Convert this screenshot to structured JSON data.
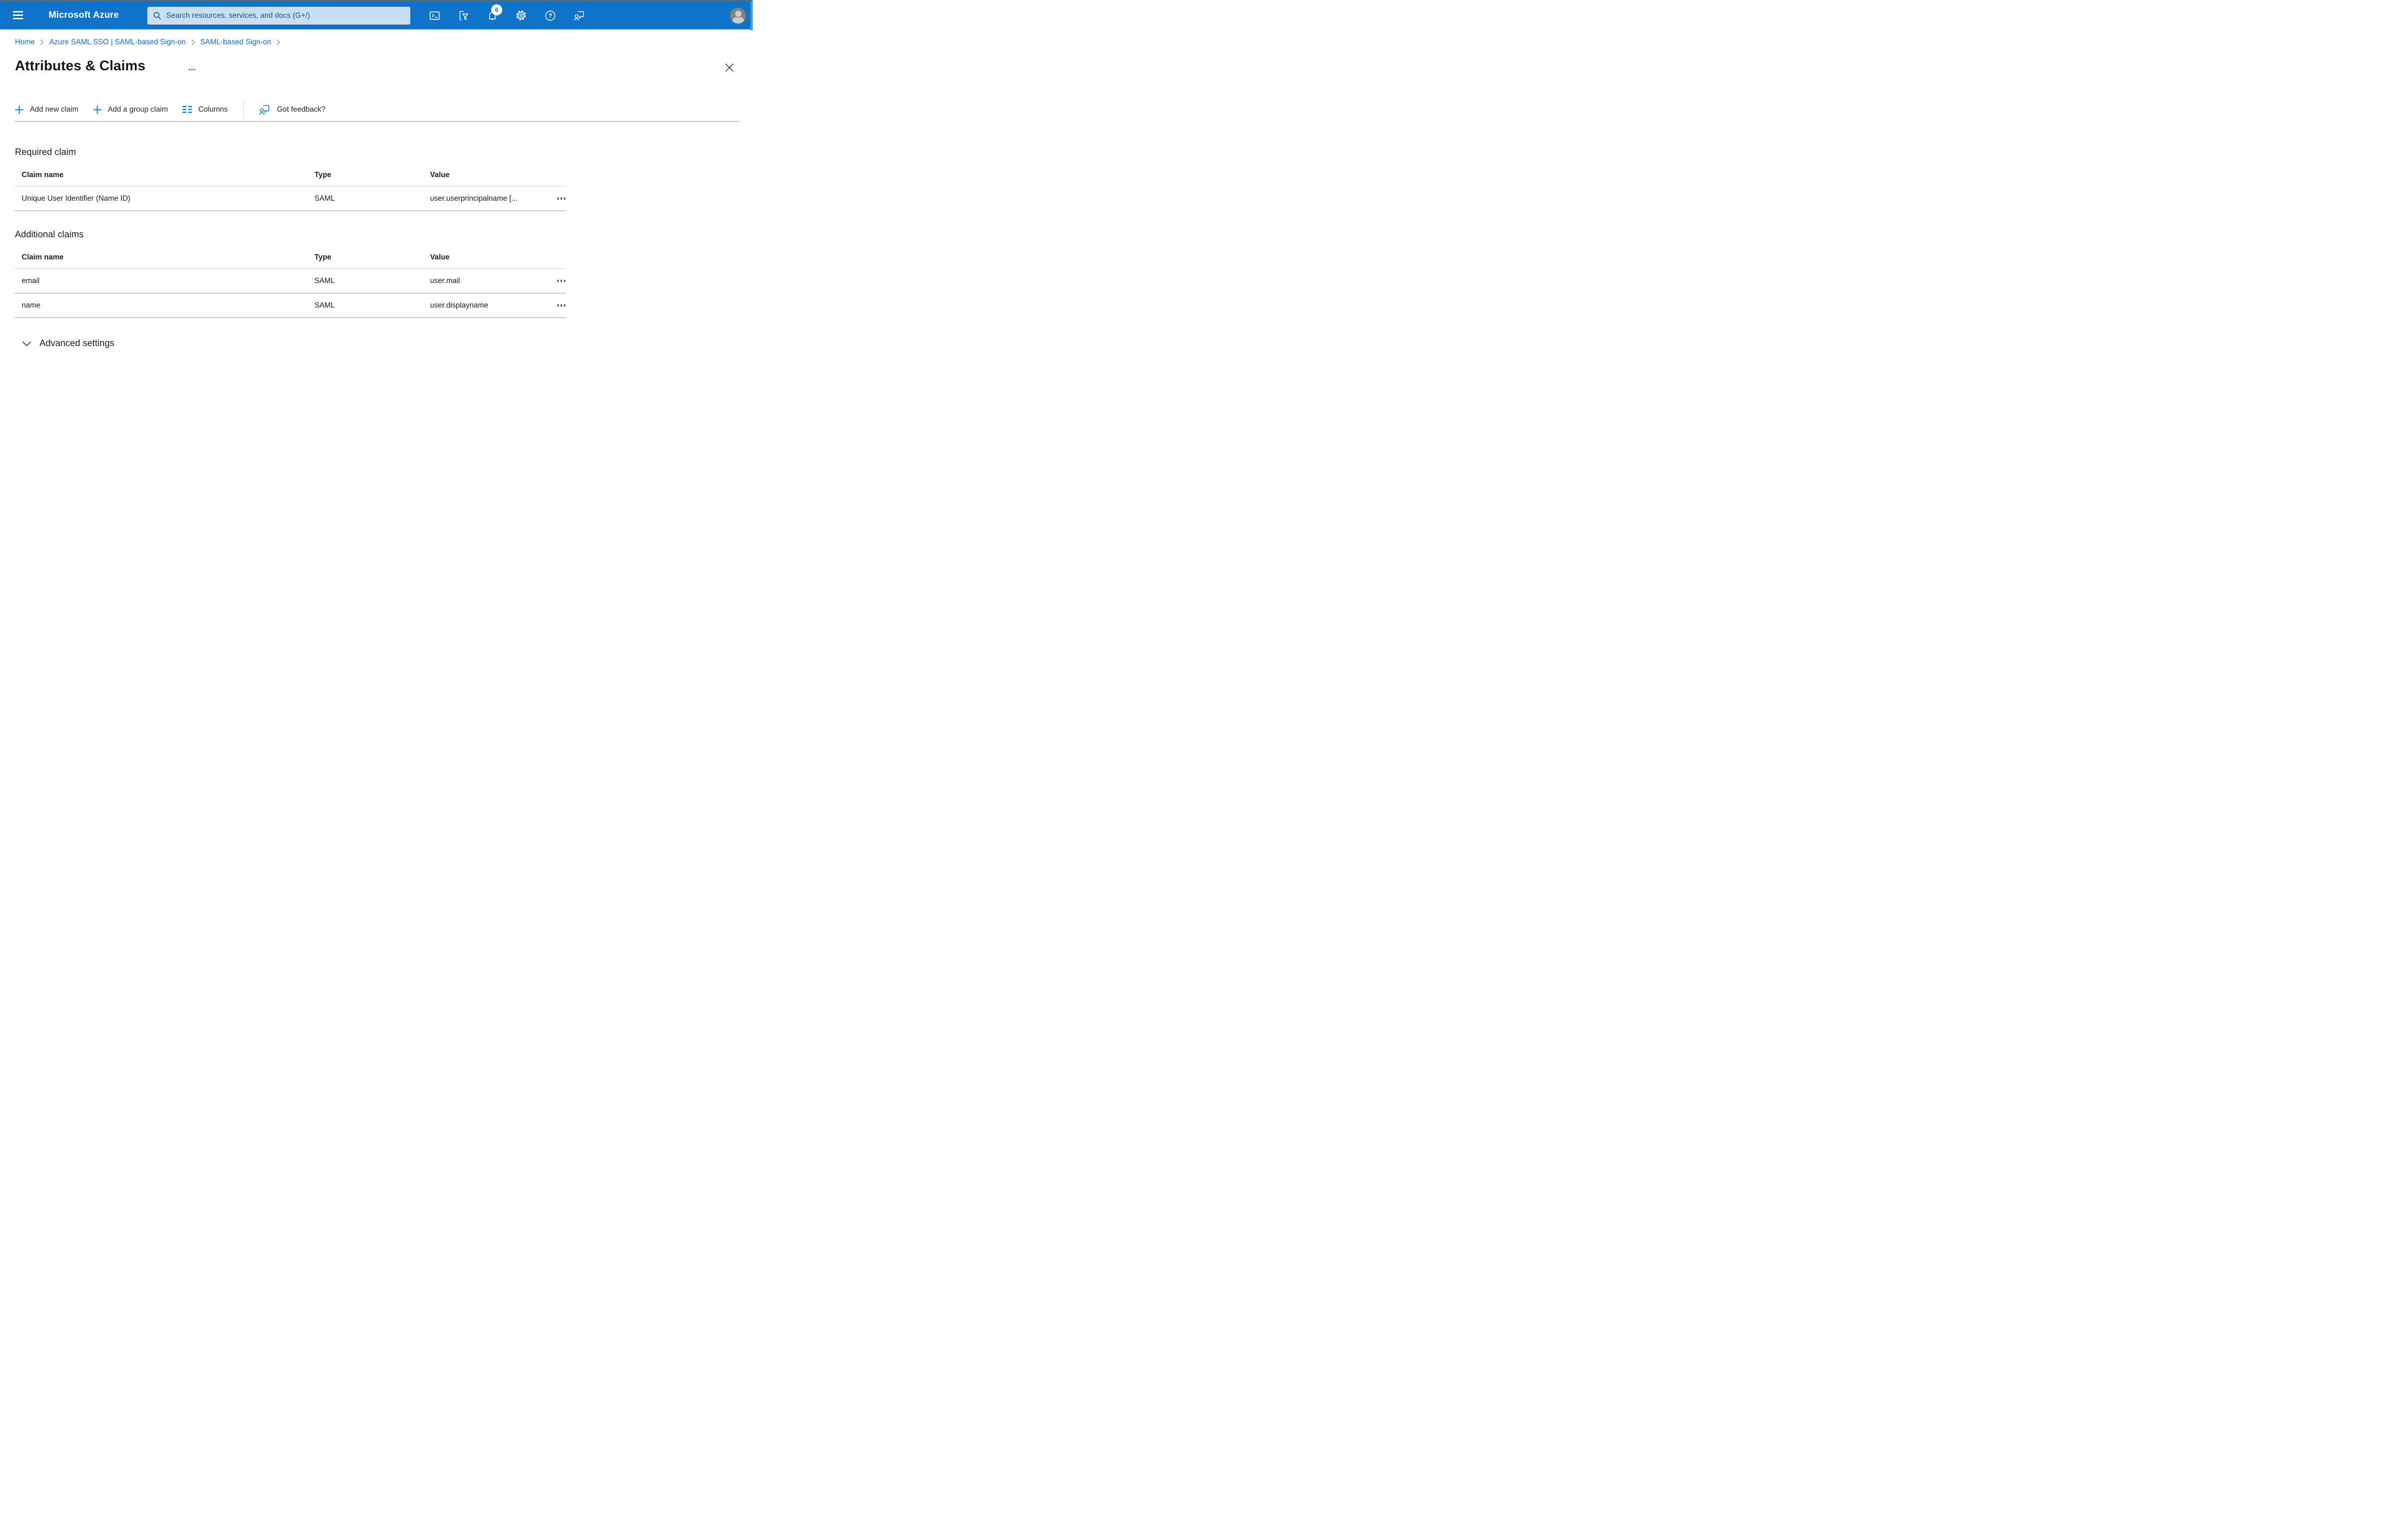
{
  "topbar": {
    "brand": "Microsoft Azure",
    "search": {
      "placeholder": "Search resources, services, and docs (G+/)"
    },
    "notifications_badge": "6"
  },
  "breadcrumb": {
    "items": [
      {
        "label": "Home"
      },
      {
        "label": "Azure SAML SSO | SAML-based Sign-on"
      },
      {
        "label": "SAML-based Sign-on"
      }
    ]
  },
  "page": {
    "title": "Attributes & Claims"
  },
  "toolbar": {
    "add_new_claim": "Add new claim",
    "add_group_claim": "Add a group claim",
    "columns": "Columns",
    "feedback": "Got feedback?"
  },
  "sections": {
    "required": {
      "heading": "Required claim",
      "columns": [
        "Claim name",
        "Type",
        "Value"
      ],
      "rows": [
        {
          "claim_name": "Unique User Identifier (Name ID)",
          "type": "SAML",
          "value": "user.userprincipalname [..."
        }
      ]
    },
    "additional": {
      "heading": "Additional claims",
      "columns": [
        "Claim name",
        "Type",
        "Value"
      ],
      "rows": [
        {
          "claim_name": "email",
          "type": "SAML",
          "value": "user.mail"
        },
        {
          "claim_name": "name",
          "type": "SAML",
          "value": "user.displayname"
        }
      ]
    }
  },
  "advanced": {
    "label": "Advanced settings"
  },
  "colors": {
    "topbar_blue": "#0e73c9",
    "search_bg": "#c9e0f4",
    "search_text": "#12528f",
    "link_blue": "#0c6cd5",
    "command_icon_blue": "#1580d8",
    "divider_gray": "#d8d6d4",
    "text_dark": "#1b1a19"
  }
}
